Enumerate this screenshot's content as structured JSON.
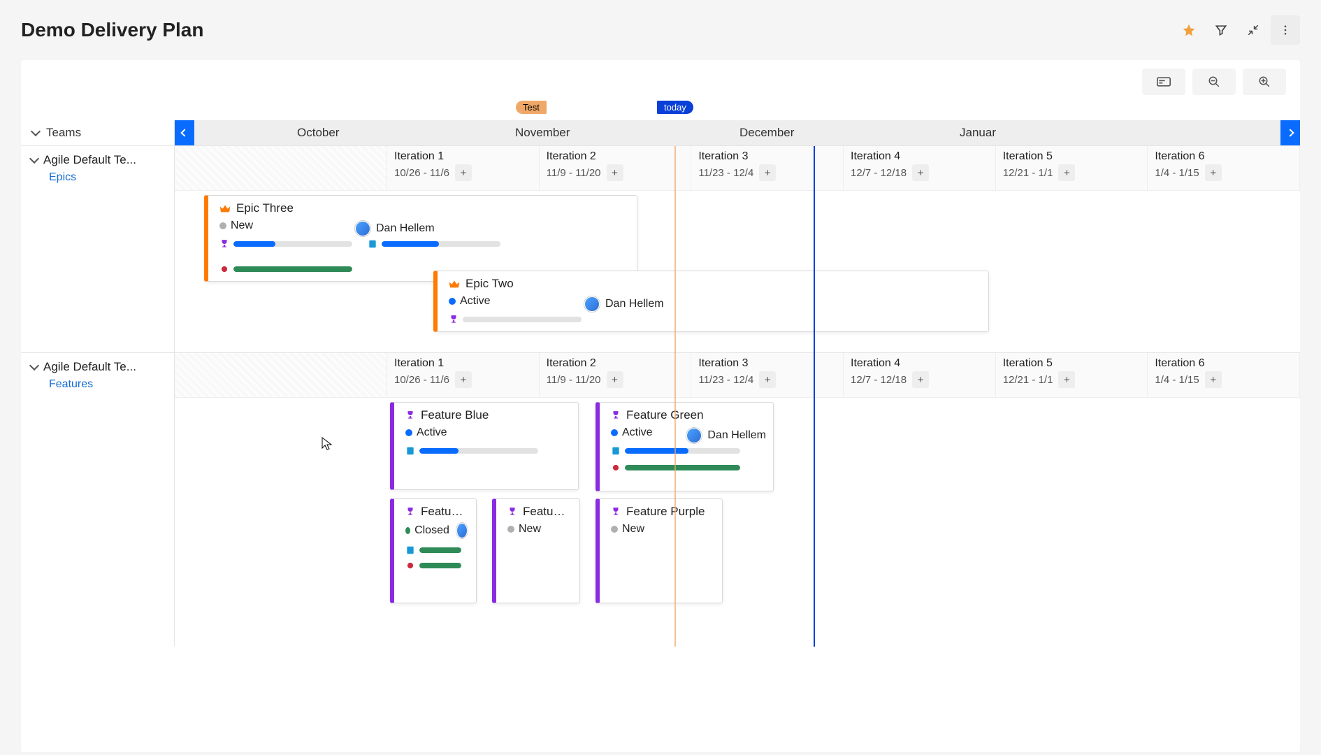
{
  "header": {
    "title": "Demo Delivery Plan"
  },
  "markers": {
    "test": "Test",
    "today": "today"
  },
  "months": {
    "oct": "October",
    "nov": "November",
    "dec": "December",
    "jan": "Januar"
  },
  "teams_label": "Teams",
  "iterations": [
    {
      "name": "Iteration 1",
      "dates": "10/26 - 11/6"
    },
    {
      "name": "Iteration 2",
      "dates": "11/9 - 11/20"
    },
    {
      "name": "Iteration 3",
      "dates": "11/23 - 12/4"
    },
    {
      "name": "Iteration 4",
      "dates": "12/7 - 12/18"
    },
    {
      "name": "Iteration 5",
      "dates": "12/21 - 1/1"
    },
    {
      "name": "Iteration 6",
      "dates": "1/4 - 1/15"
    }
  ],
  "lanes": [
    {
      "team": "Agile Default Te...",
      "backlog": "Epics",
      "cards": [
        {
          "kind": "epic",
          "title": "Epic Three",
          "status": "New",
          "status_kind": "new",
          "assignee": "Dan Hellem"
        },
        {
          "kind": "epic",
          "title": "Epic Two",
          "status": "Active",
          "status_kind": "active",
          "assignee": "Dan Hellem"
        }
      ]
    },
    {
      "team": "Agile Default Te...",
      "backlog": "Features",
      "cards": [
        {
          "kind": "feature",
          "title": "Feature Blue",
          "status": "Active",
          "status_kind": "active"
        },
        {
          "kind": "feature",
          "title": "Feature Green",
          "status": "Active",
          "status_kind": "active",
          "assignee": "Dan Hellem"
        },
        {
          "kind": "feature",
          "title": "Feature ...",
          "status": "Closed",
          "status_kind": "closed"
        },
        {
          "kind": "feature",
          "title": "Feature ...",
          "status": "New",
          "status_kind": "new"
        },
        {
          "kind": "feature",
          "title": "Feature Purple",
          "status": "New",
          "status_kind": "new"
        }
      ]
    }
  ],
  "icons": {
    "crown": "crown-icon",
    "trophy": "trophy-icon",
    "bug": "bug-icon",
    "book": "book-icon"
  },
  "colors": {
    "epic_accent": "#ff7a00",
    "feature_accent": "#8a2be2",
    "blue": "#0a6cff",
    "green": "#2e8b57",
    "today": "#0a3fd8",
    "test": "#f0a868"
  }
}
